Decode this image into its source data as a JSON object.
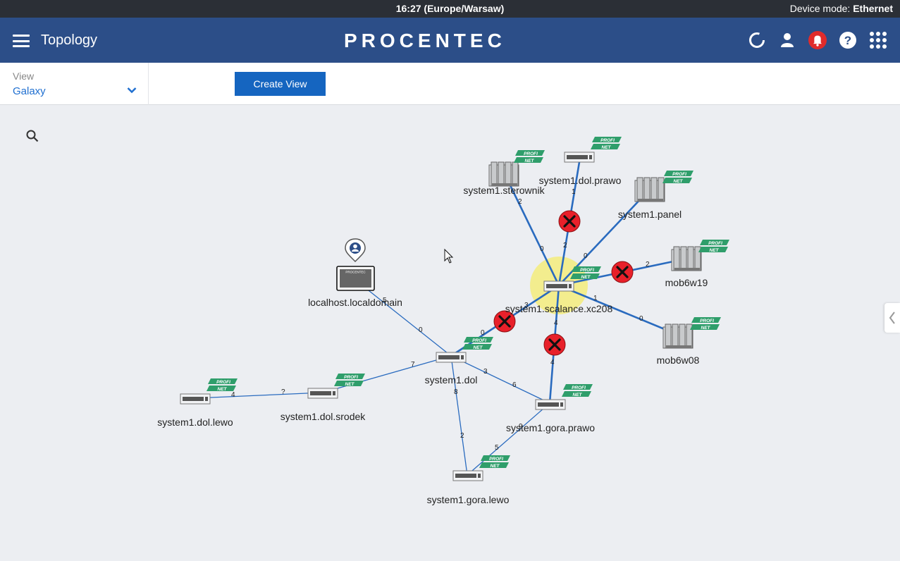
{
  "status_bar": {
    "time": "16:27 (Europe/Warsaw)",
    "mode_label": "Device mode:",
    "mode_value": "Ethernet"
  },
  "app_bar": {
    "title": "Topology",
    "brand": "PROCENTEC"
  },
  "toolbar": {
    "view_label": "View",
    "view_value": "Galaxy",
    "create_view": "Create View"
  },
  "topology": {
    "nodes": {
      "sterownik": "system1.sterownik",
      "dol_prawo": "system1.dol.prawo",
      "panel": "system1.panel",
      "mob6w19": "mob6w19",
      "scalance": "system1.scalance.xc208",
      "mob6w08": "mob6w08",
      "localhost": "localhost.localdomain",
      "dol": "system1.dol",
      "dol_lewo": "system1.dol.lewo",
      "dol_srodek": "system1.dol.srodek",
      "gora_prawo": "system1.gora.prawo",
      "gora_lewo": "system1.gora.lewo"
    },
    "port_labels": [
      "2",
      "1",
      "2",
      "0",
      "0",
      "2",
      "1",
      "0",
      "3",
      "4",
      "4",
      "0",
      "5",
      "0",
      "7",
      "3",
      "6",
      "8",
      "2",
      "5",
      "9",
      "?",
      "4"
    ],
    "badge_text": "PROFI NET",
    "device_label": "PROCENTEC"
  },
  "colors": {
    "header": "#2c4e88",
    "accent": "#1565c0",
    "link": "#2a6bbf",
    "error": "#e8202a",
    "highlight": "#f4ec7c",
    "profinet": "#2f9e6b"
  }
}
